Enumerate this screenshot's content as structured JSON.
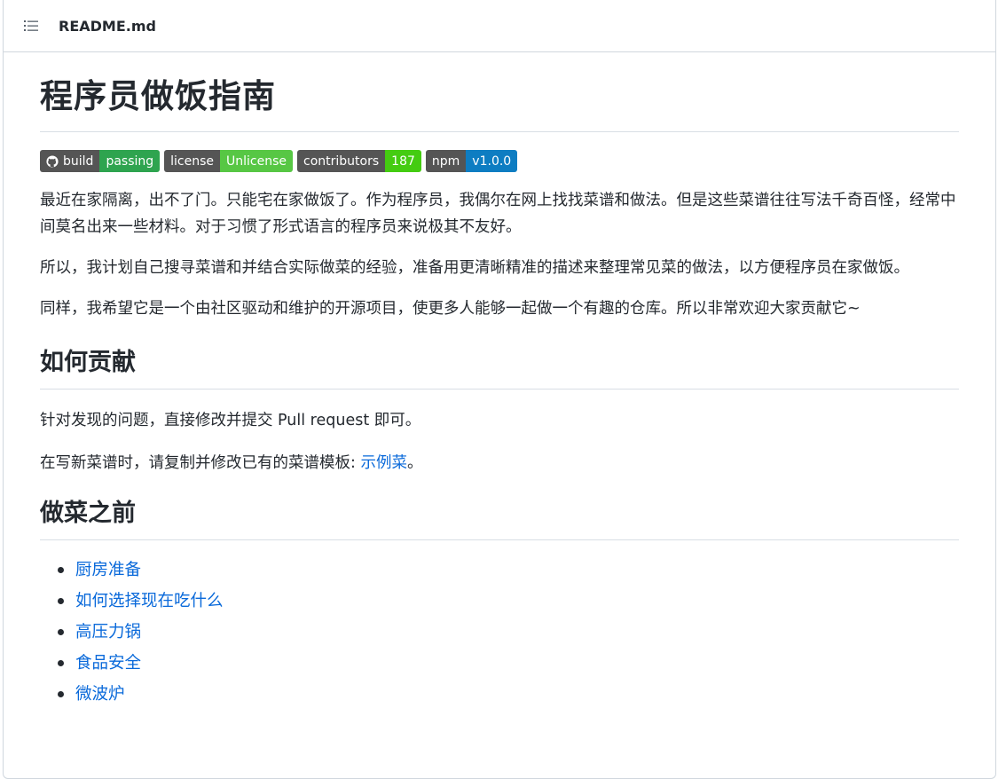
{
  "file": {
    "name": "README.md"
  },
  "title": "程序员做饭指南",
  "badges": [
    {
      "left": "build",
      "right": "passing",
      "color": "#4c1",
      "icon": "github-icon"
    },
    {
      "left": "license",
      "right": "Unlicense",
      "color": "#57c744"
    },
    {
      "left": "contributors",
      "right": "187",
      "color": "#4c1"
    },
    {
      "left": "npm",
      "right": "v1.0.0",
      "color": "#0e7dc2"
    }
  ],
  "intro": [
    "最近在家隔离，出不了门。只能宅在家做饭了。作为程序员，我偶尔在网上找找菜谱和做法。但是这些菜谱往往写法千奇百怪，经常中间莫名出来一些材料。对于习惯了形式语言的程序员来说极其不友好。",
    "所以，我计划自己搜寻菜谱和并结合实际做菜的经验，准备用更清晰精准的描述来整理常见菜的做法，以方便程序员在家做饭。",
    "同样，我希望它是一个由社区驱动和维护的开源项目，使更多人能够一起做一个有趣的仓库。所以非常欢迎大家贡献它~"
  ],
  "contribute": {
    "heading": "如何贡献",
    "line1": "针对发现的问题，直接修改并提交 Pull request 即可。",
    "line2_prefix": "在写新菜谱时，请复制并修改已有的菜谱模板: ",
    "line2_link": "示例菜",
    "line2_suffix": "。"
  },
  "before": {
    "heading": "做菜之前",
    "items": [
      "厨房准备",
      "如何选择现在吃什么",
      "高压力锅",
      "食品安全",
      "微波炉"
    ]
  },
  "colors": {
    "link": "#0969da",
    "text": "#24292f",
    "border": "#d0d7de"
  }
}
